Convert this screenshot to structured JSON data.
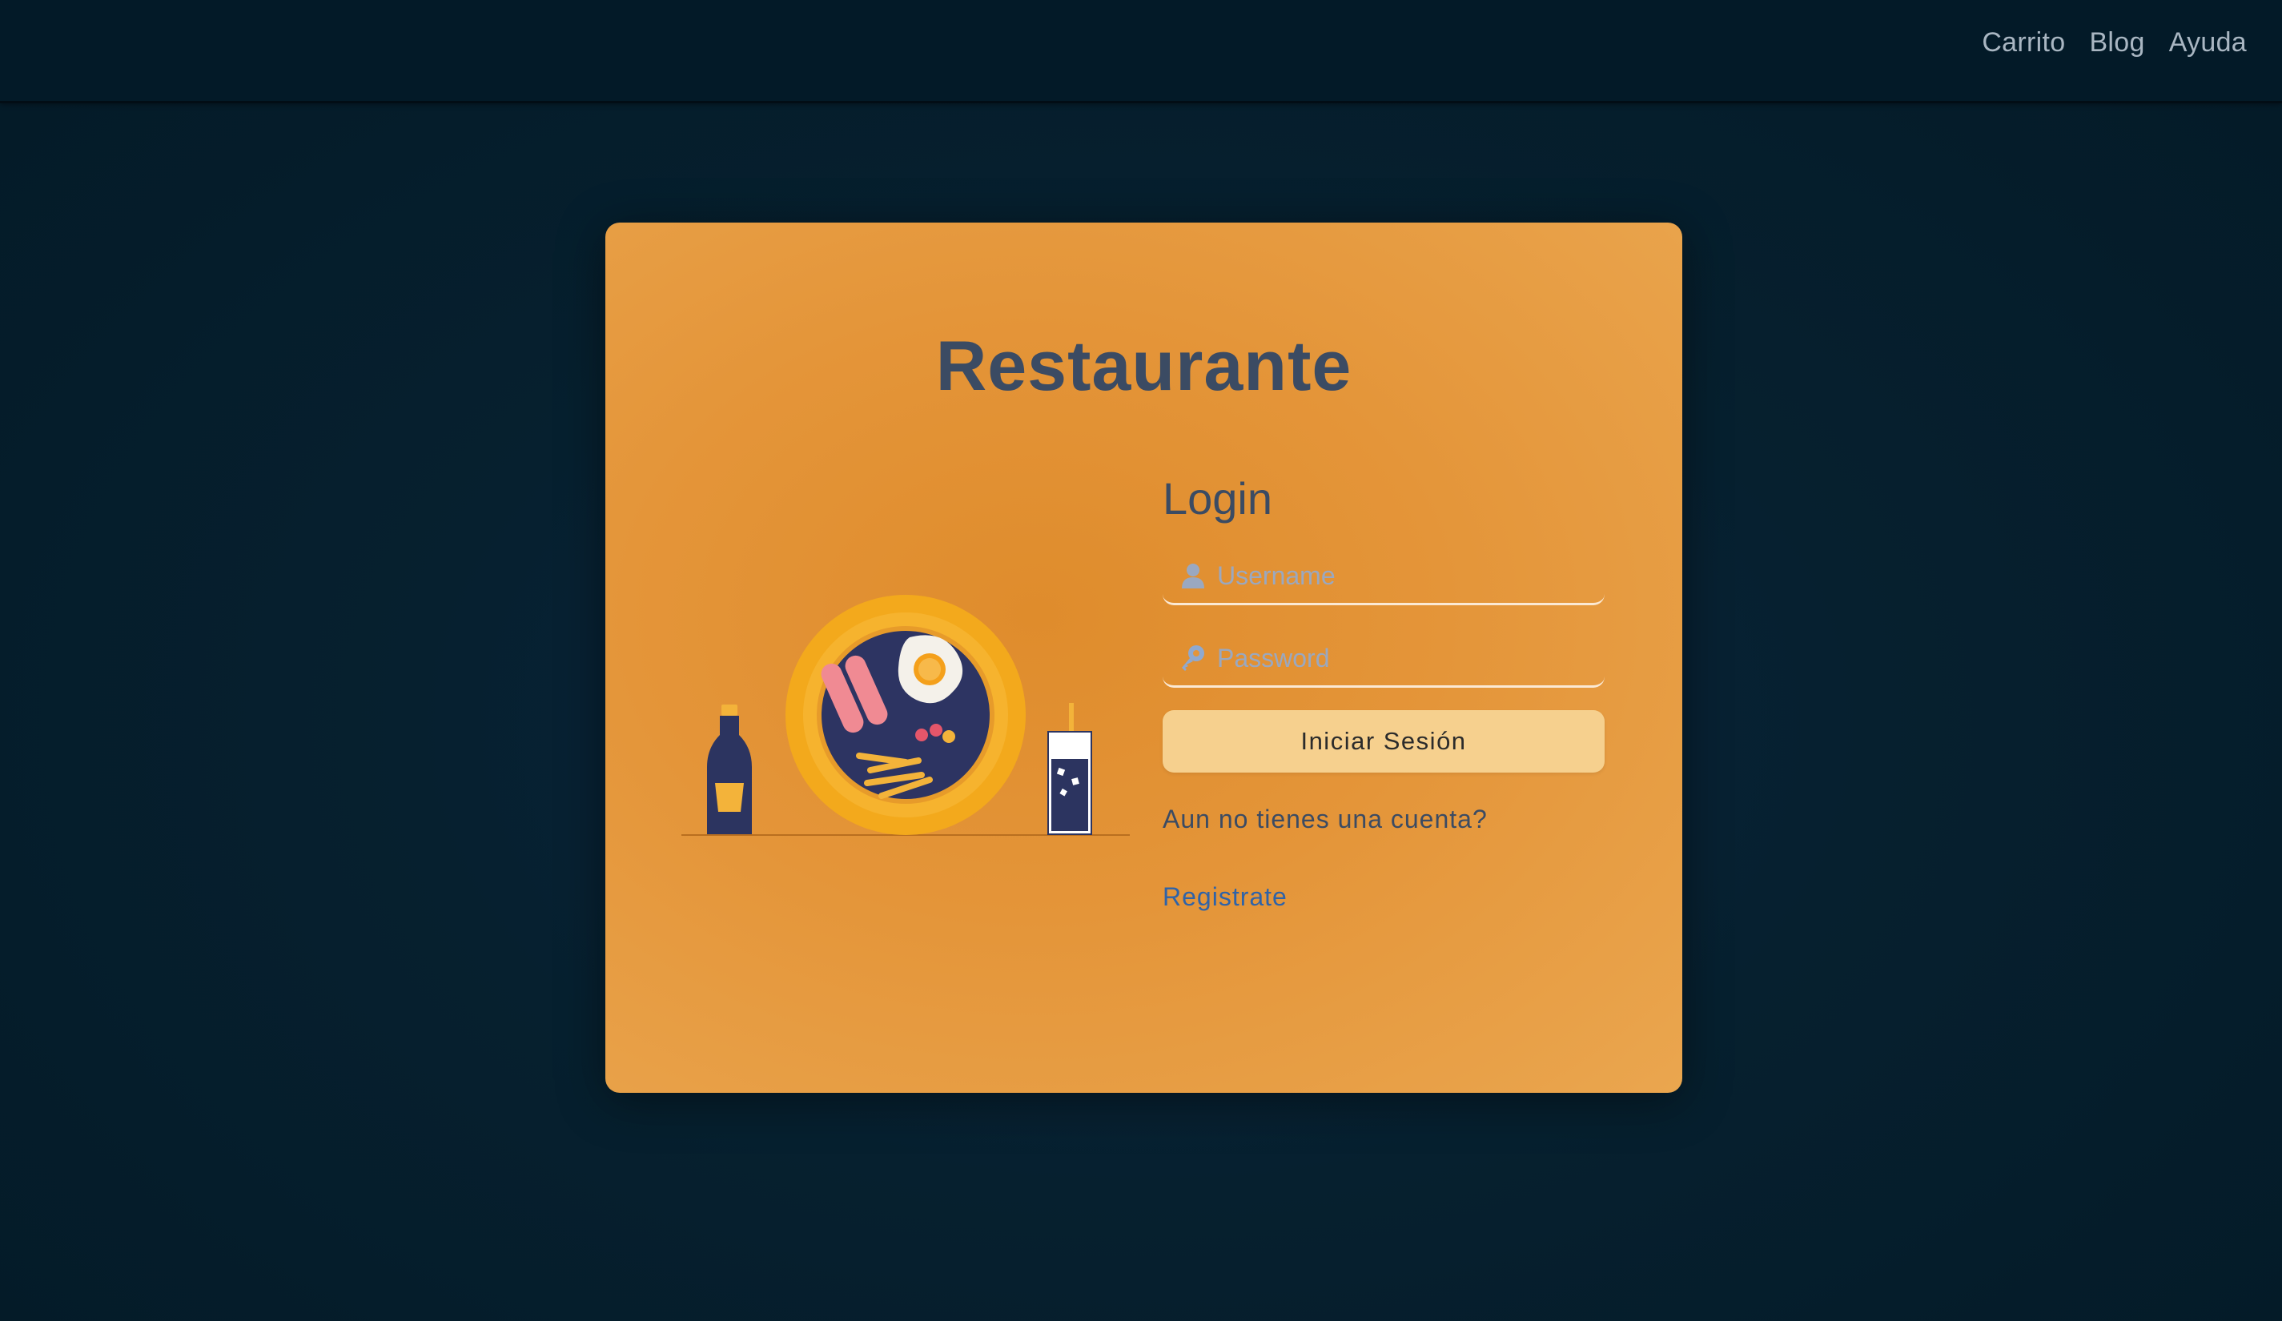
{
  "nav": {
    "cart": "Carrito",
    "blog": "Blog",
    "help": "Ayuda"
  },
  "card": {
    "title": "Restaurante"
  },
  "login": {
    "heading": "Login",
    "username_placeholder": "Username",
    "password_placeholder": "Password",
    "submit_label": "Iniciar Sesión",
    "no_account_text": "Aun no tienes una cuenta?",
    "register_link": "Registrate"
  },
  "icons": {
    "username": "user-icon",
    "password": "key-icon"
  },
  "colors": {
    "page_background": "#041a27",
    "card_accent": "#e49539",
    "title_text": "#3b4b63",
    "button": "#f6d08e",
    "link": "#2f63a8"
  }
}
